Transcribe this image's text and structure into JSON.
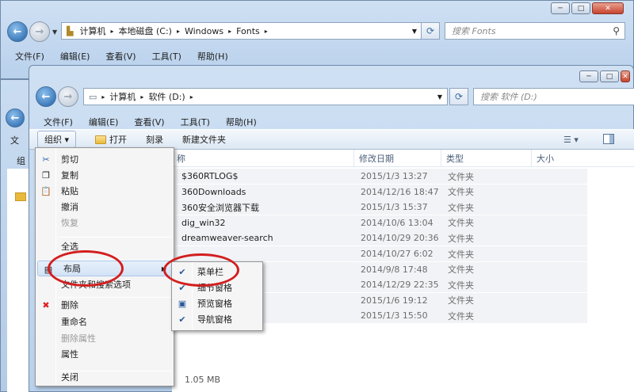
{
  "back_window": {
    "address": [
      "计算机",
      "本地磁盘 (C:)",
      "Windows",
      "Fonts"
    ],
    "search_placeholder": "搜索 Fonts",
    "menu": [
      "文件(F)",
      "编辑(E)",
      "查看(V)",
      "工具(T)",
      "帮助(H)"
    ]
  },
  "far_window": {
    "menu_fragment": "文",
    "toolbar_fragment": "组"
  },
  "front_window": {
    "address": [
      "计算机",
      "软件 (D:)"
    ],
    "search_placeholder": "搜索 软件 (D:)",
    "menu": [
      "文件(F)",
      "编辑(E)",
      "查看(V)",
      "工具(T)",
      "帮助(H)"
    ],
    "toolbar": {
      "organize": "组织 ▾",
      "open": "打开",
      "burn": "刻录",
      "new_folder": "新建文件夹"
    },
    "columns": {
      "name": "称",
      "date": "修改日期",
      "type": "类型",
      "size": "大小"
    },
    "files": [
      {
        "name": "$360RTLOG$",
        "date": "2015/1/3 13:27",
        "type": "文件夹"
      },
      {
        "name": "360Downloads",
        "date": "2014/12/16 18:47",
        "type": "文件夹"
      },
      {
        "name": "360安全浏览器下载",
        "date": "2015/1/3 15:37",
        "type": "文件夹"
      },
      {
        "name": "dig_win32",
        "date": "2014/10/6 13:04",
        "type": "文件夹"
      },
      {
        "name": "dreamweaver-search",
        "date": "2014/10/29 20:36",
        "type": "文件夹"
      },
      {
        "name": "",
        "date": "2014/10/27 6:02",
        "type": "文件夹"
      },
      {
        "name": "",
        "date": "2014/9/8 17:48",
        "type": "文件夹"
      },
      {
        "name": "",
        "date": "2014/12/29 22:35",
        "type": "文件夹"
      },
      {
        "name": "",
        "date": "2015/1/6 19:12",
        "type": "文件夹"
      },
      {
        "name": "",
        "date": "2015/1/3 15:50",
        "type": "文件夹"
      }
    ],
    "status_fragment": "1.05 MB"
  },
  "organize_menu": [
    {
      "label": "剪切",
      "icon": "scissors-icon",
      "disabled": false
    },
    {
      "label": "复制",
      "icon": "copy-icon",
      "disabled": false
    },
    {
      "label": "粘贴",
      "icon": "paste-icon",
      "disabled": false
    },
    {
      "label": "撤消",
      "icon": "",
      "disabled": false
    },
    {
      "label": "恢复",
      "icon": "",
      "disabled": true
    },
    {
      "label": "全选",
      "icon": "",
      "disabled": false
    },
    {
      "label": "布局",
      "icon": "layout-icon",
      "disabled": false,
      "submenu": true
    },
    {
      "label": "文件夹和搜索选项",
      "icon": "",
      "disabled": false
    },
    {
      "label": "删除",
      "icon": "delete-icon",
      "disabled": false
    },
    {
      "label": "重命名",
      "icon": "",
      "disabled": false
    },
    {
      "label": "删除属性",
      "icon": "",
      "disabled": true
    },
    {
      "label": "属性",
      "icon": "",
      "disabled": false
    },
    {
      "label": "关闭",
      "icon": "",
      "disabled": false
    }
  ],
  "layout_submenu": [
    {
      "label": "菜单栏",
      "checked": true
    },
    {
      "label": "细节窗格",
      "checked": true
    },
    {
      "label": "预览窗格",
      "checked": false
    },
    {
      "label": "导航窗格",
      "checked": true
    }
  ]
}
